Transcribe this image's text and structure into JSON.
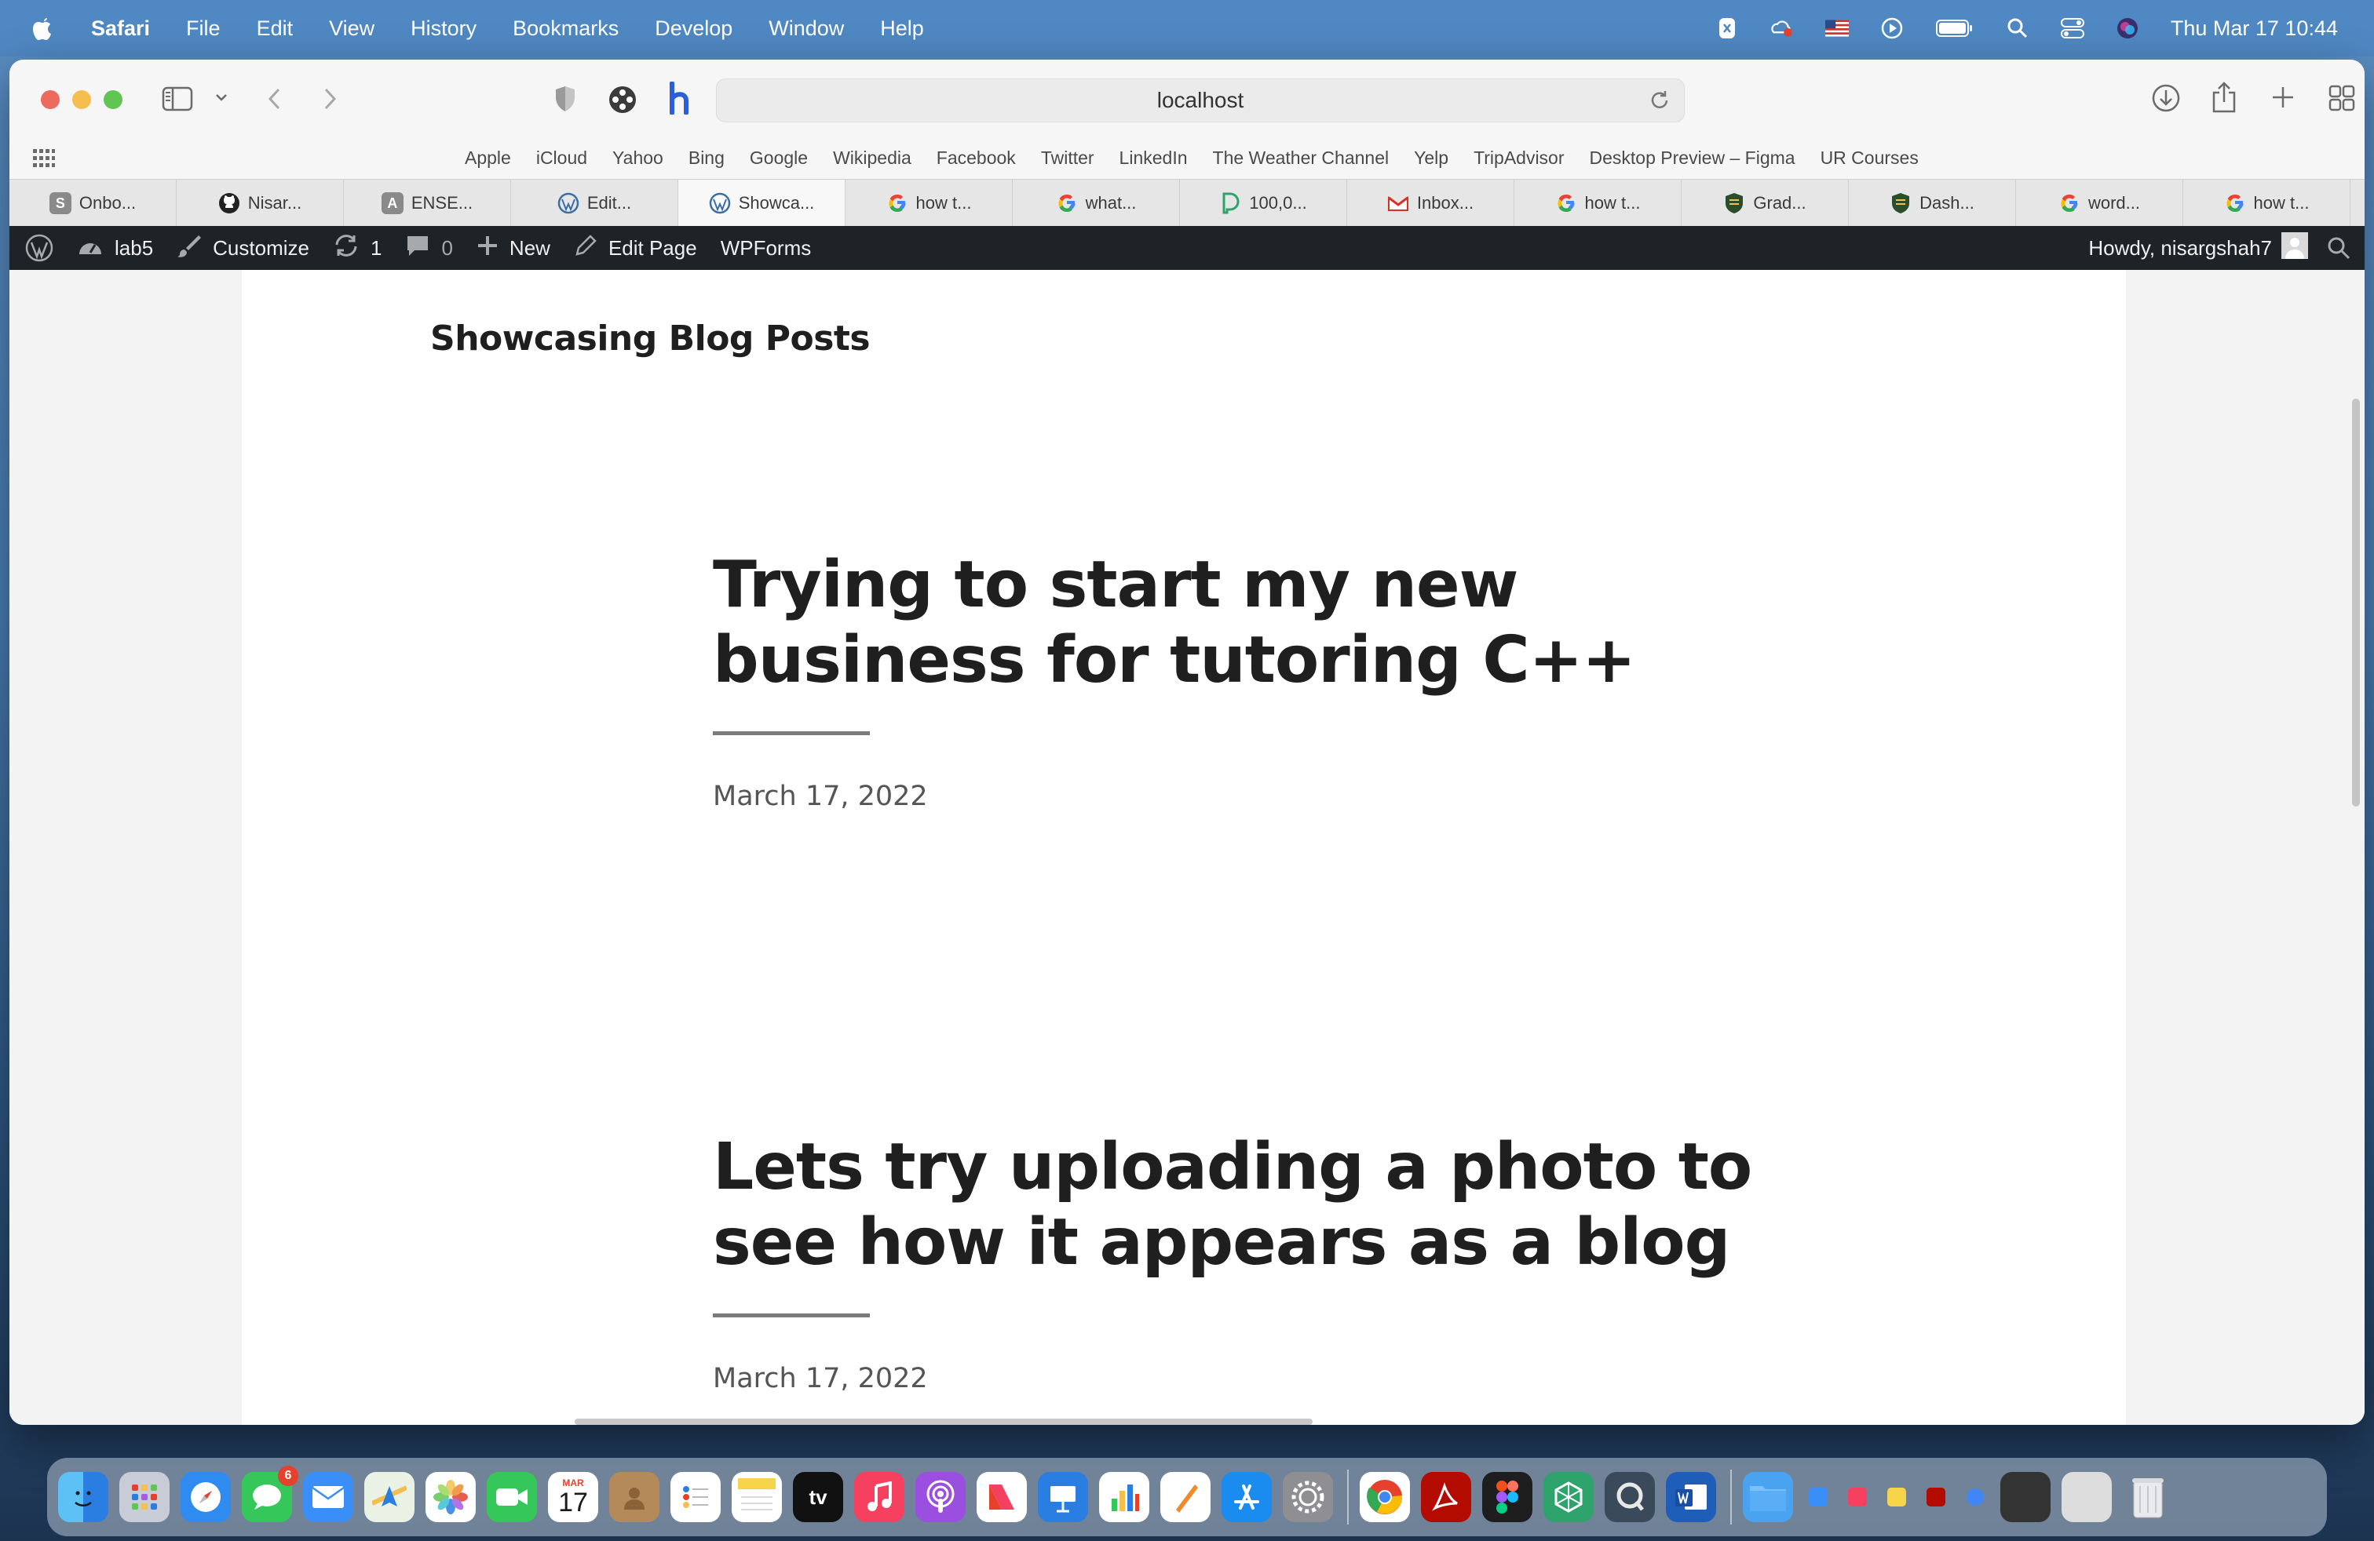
{
  "menubar": {
    "app_name": "Safari",
    "items": [
      "File",
      "Edit",
      "View",
      "History",
      "Bookmarks",
      "Develop",
      "Window",
      "Help"
    ],
    "clock": "Thu Mar 17  10:44"
  },
  "browser": {
    "url": "localhost",
    "favorites": [
      "Apple",
      "iCloud",
      "Yahoo",
      "Bing",
      "Google",
      "Wikipedia",
      "Facebook",
      "Twitter",
      "LinkedIn",
      "The Weather Channel",
      "Yelp",
      "TripAdvisor",
      "Desktop Preview – Figma",
      "UR Courses"
    ],
    "tabs": [
      {
        "label": "Onbo...",
        "icon": "S",
        "color": "#8a8a8a"
      },
      {
        "label": "Nisar...",
        "icon": "github",
        "color": "#222222"
      },
      {
        "label": "ENSE...",
        "icon": "A",
        "color": "#8a8a8a"
      },
      {
        "label": "Edit...",
        "icon": "W",
        "color": "#3a6ea5"
      },
      {
        "label": "Showca...",
        "icon": "W",
        "color": "#3a6ea5",
        "active": true
      },
      {
        "label": "how t...",
        "icon": "G",
        "color": "#4285f4"
      },
      {
        "label": "what...",
        "icon": "G",
        "color": "#4285f4"
      },
      {
        "label": "100,0...",
        "icon": "D",
        "color": "#2ea36c"
      },
      {
        "label": "Inbox...",
        "icon": "M",
        "color": "#d93025"
      },
      {
        "label": "how t...",
        "icon": "G",
        "color": "#4285f4"
      },
      {
        "label": "Grad...",
        "icon": "shield",
        "color": "#2a4d2a"
      },
      {
        "label": "Dash...",
        "icon": "shield",
        "color": "#2a4d2a"
      },
      {
        "label": "word...",
        "icon": "G",
        "color": "#4285f4"
      },
      {
        "label": "how t...",
        "icon": "G",
        "color": "#4285f4"
      }
    ]
  },
  "adminbar": {
    "site_name": "lab5",
    "customize": "Customize",
    "updates": "1",
    "comments": "0",
    "new": "New",
    "edit_page": "Edit Page",
    "wpforms": "WPForms",
    "howdy": "Howdy, nisargshah7"
  },
  "page": {
    "site_title": "Showcasing Blog Posts",
    "posts": [
      {
        "title": "Trying to start my new business for tutoring C++",
        "date": "March 17, 2022"
      },
      {
        "title": "Lets try uploading a photo to see how it appears as a blog",
        "date": "March 17, 2022"
      }
    ]
  },
  "dock": {
    "calendar_month": "MAR",
    "calendar_day": "17",
    "messages_badge": "6",
    "tv_label": "tv"
  }
}
